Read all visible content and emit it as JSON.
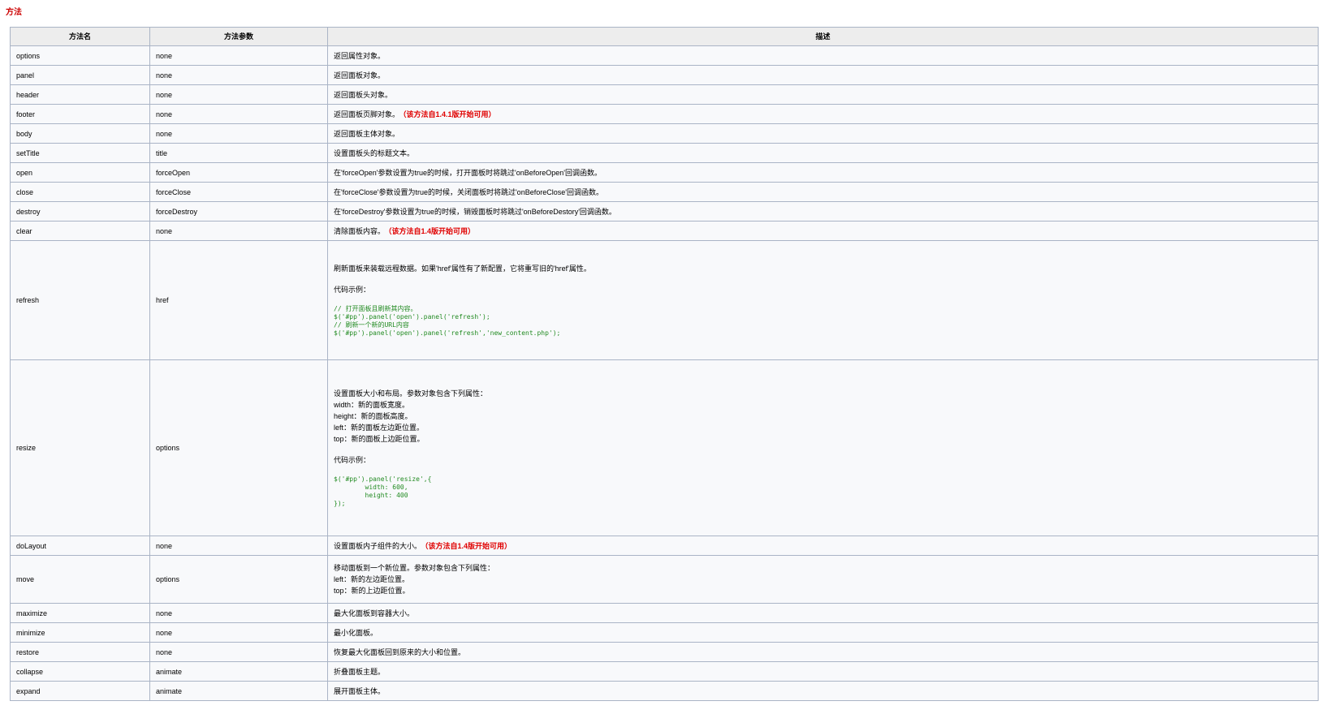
{
  "section_title": "方法",
  "columns": [
    "方法名",
    "方法参数",
    "描述"
  ],
  "rows": [
    {
      "name": "options",
      "param": "none",
      "desc": "返回属性对象。",
      "note": ""
    },
    {
      "name": "panel",
      "param": "none",
      "desc": "返回面板对象。",
      "note": ""
    },
    {
      "name": "header",
      "param": "none",
      "desc": "返回面板头对象。",
      "note": ""
    },
    {
      "name": "footer",
      "param": "none",
      "desc": "返回面板页脚对象。",
      "note": "（该方法自1.4.1版开始可用）"
    },
    {
      "name": "body",
      "param": "none",
      "desc": "返回面板主体对象。",
      "note": ""
    },
    {
      "name": "setTitle",
      "param": "title",
      "desc": "设置面板头的标题文本。",
      "note": ""
    },
    {
      "name": "open",
      "param": "forceOpen",
      "desc": "在'forceOpen'参数设置为true的时候，打开面板时将跳过'onBeforeOpen'回调函数。",
      "note": ""
    },
    {
      "name": "close",
      "param": "forceClose",
      "desc": "在'forceClose'参数设置为true的时候，关闭面板时将跳过'onBeforeClose'回调函数。",
      "note": ""
    },
    {
      "name": "destroy",
      "param": "forceDestroy",
      "desc": "在'forceDestroy'参数设置为true的时候，销毁面板时将跳过'onBeforeDestory'回调函数。",
      "note": ""
    },
    {
      "name": "clear",
      "param": "none",
      "desc": "清除面板内容。",
      "note": "（该方法自1.4版开始可用）"
    }
  ],
  "refresh": {
    "name": "refresh",
    "param": "href",
    "desc": "刷新面板来装载远程数据。如果'href'属性有了新配置，它将重写旧的'href'属性。",
    "example_label": "代码示例：",
    "code": "// 打开面板且刷新其内容。\n$('#pp').panel('open').panel('refresh');\n// 刷新一个新的URL内容\n$('#pp').panel('open').panel('refresh','new_content.php');"
  },
  "resize": {
    "name": "resize",
    "param": "options",
    "desc": "设置面板大小和布局。参数对象包含下列属性：",
    "props": [
      "width：新的面板宽度。",
      "height：新的面板高度。",
      "left：新的面板左边距位置。",
      "top：新的面板上边距位置。"
    ],
    "example_label": "代码示例：",
    "code": "$('#pp').panel('resize',{\n\twidth: 600,\n\theight: 400\n});"
  },
  "dolayout": {
    "name": "doLayout",
    "param": "none",
    "desc": "设置面板内子组件的大小。",
    "note": "（该方法自1.4版开始可用）"
  },
  "move": {
    "name": "move",
    "param": "options",
    "desc": "移动面板到一个新位置。参数对象包含下列属性：",
    "props": [
      "left：新的左边距位置。",
      "top：新的上边距位置。"
    ]
  },
  "rows2": [
    {
      "name": "maximize",
      "param": "none",
      "desc": "最大化面板到容器大小。",
      "note": ""
    },
    {
      "name": "minimize",
      "param": "none",
      "desc": "最小化面板。",
      "note": ""
    },
    {
      "name": "restore",
      "param": "none",
      "desc": "恢复最大化面板回到原来的大小和位置。",
      "note": ""
    },
    {
      "name": "collapse",
      "param": "animate",
      "desc": "折叠面板主题。",
      "note": ""
    },
    {
      "name": "expand",
      "param": "animate",
      "desc": "展开面板主体。",
      "note": ""
    }
  ]
}
